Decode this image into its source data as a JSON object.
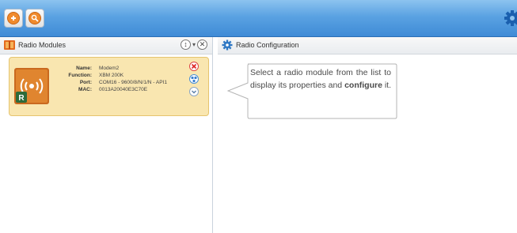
{
  "toolbar": {
    "add_module_icon": "add-circle-icon",
    "discover_icon": "search-circle-icon",
    "settings_icon": "gear-icon",
    "accent_color": "#f08a2c"
  },
  "radio_modules": {
    "title": "Radio Modules",
    "controls": [
      "sort-icon",
      "close-icon"
    ],
    "modules": [
      {
        "fields": [
          {
            "label": "Name:",
            "value": "Modem2"
          },
          {
            "label": "Function:",
            "value": "XBM 200K"
          },
          {
            "label": "Port:",
            "value": "COM16 - 9600/8/N/1/N - API1"
          },
          {
            "label": "MAC:",
            "value": "0013A20040E3C70E"
          }
        ],
        "badge": "R"
      }
    ]
  },
  "radio_configuration": {
    "title": "Radio Configuration",
    "message_part1": "Select a radio module from the list to display its properties and ",
    "message_bold": "configure",
    "message_part2": " it."
  }
}
